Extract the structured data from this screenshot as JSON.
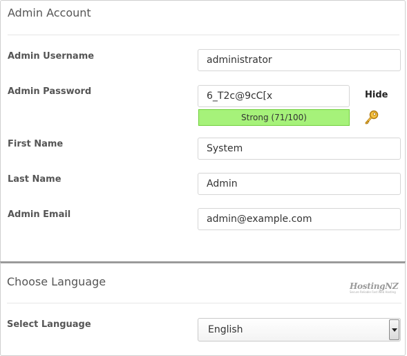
{
  "admin_account": {
    "title": "Admin Account",
    "fields": {
      "username": {
        "label": "Admin Username",
        "value": "administrator"
      },
      "password": {
        "label": "Admin Password",
        "value": "6_T2c@9cC[x",
        "strength_text": "Strong (71/100)",
        "strength_score": 71,
        "toggle_label": "Hide"
      },
      "first_name": {
        "label": "First Name",
        "value": "System"
      },
      "last_name": {
        "label": "Last Name",
        "value": "Admin"
      },
      "email": {
        "label": "Admin Email",
        "value": "admin@example.com"
      }
    }
  },
  "language": {
    "title": "Choose Language",
    "label": "Select Language",
    "selected": "English"
  },
  "branding": {
    "name": "HostingNZ",
    "tagline": "Secure Reliable Fast Web Hosting"
  },
  "colors": {
    "strength_bar": "#a6f27a",
    "strength_border": "#6fcf3a",
    "key_icon": "#e0a020"
  },
  "icons": {
    "password_generator": "key-icon",
    "select_arrow": "chevron-down-icon"
  }
}
